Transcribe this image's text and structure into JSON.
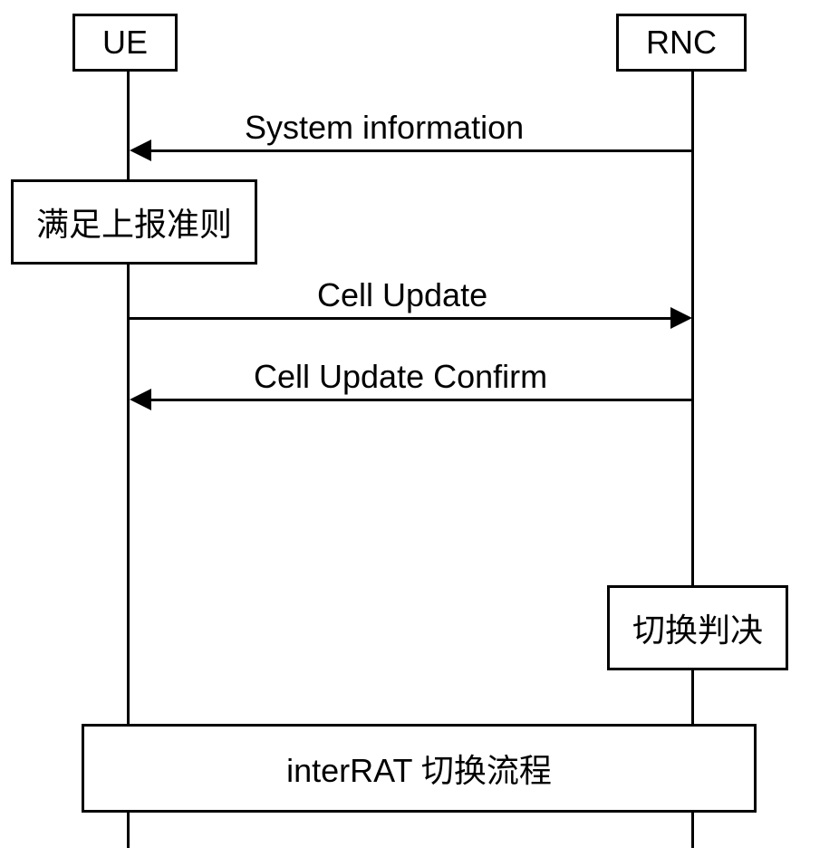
{
  "participants": {
    "left": "UE",
    "right": "RNC"
  },
  "messages": {
    "msg1": "System information",
    "msg2": "Cell Update",
    "msg3": "Cell Update Confirm"
  },
  "actions": {
    "ue_action": "满足上报准则",
    "rnc_action": "切换判决"
  },
  "process": "interRAT 切换流程"
}
